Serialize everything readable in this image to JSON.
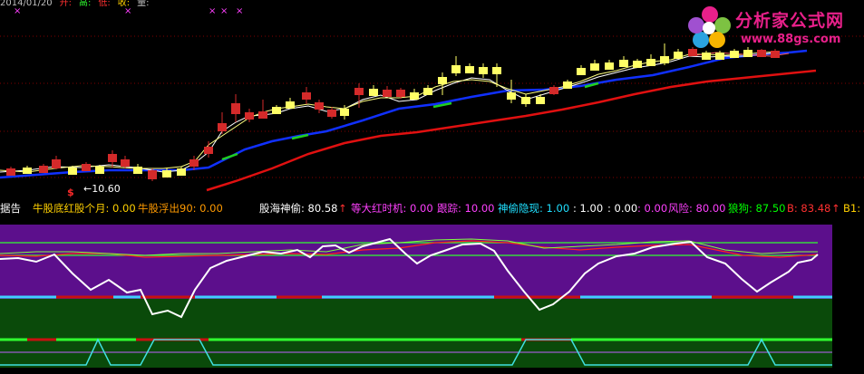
{
  "logo": {
    "title": "分析家公式网",
    "url": "www.88gs.com"
  },
  "price_chart": {
    "low_marker": "←10.60",
    "signal_symbol": "$"
  },
  "indicator_bar": {
    "left_label": "据告",
    "items": [
      {
        "label": "牛股底红股个月: 0.00",
        "color": "#ffd000"
      },
      {
        "label": "牛股浮出90: 0.00",
        "color": "#ff9a00"
      },
      {
        "label": "股海神偷: 80.58",
        "color": "#ffffff"
      },
      {
        "label": "等大红时机: 0.00",
        "color": "#ff40ff"
      },
      {
        "label": "跟踪: 10.00",
        "color": "#ff40ff"
      },
      {
        "label": "神偷隐现: 1.00",
        "color": "#20e0ff"
      },
      {
        "label": ": 1.00",
        "color": "#ffffff"
      },
      {
        "label": ": 0.00",
        "color": "#ffffff"
      },
      {
        "label": ": 0.00",
        "color": "#ff40ff"
      },
      {
        "label": "风险: 80.00",
        "color": "#ff40ff"
      },
      {
        "label": "狼狗: 87.50",
        "color": "#00ff00"
      },
      {
        "label": "B: 83.48",
        "color": "#ff3030"
      },
      {
        "label": "B1:",
        "color": "#ffd000"
      }
    ],
    "arrow_icon": "↑"
  },
  "colors": {
    "up": "#d42a2a",
    "down": "#ffff66",
    "ma_blue": "#1030ff",
    "ma_red": "#e01010",
    "osc_purple": "#5c0f8c",
    "osc_green": "#0a4a0a"
  }
}
